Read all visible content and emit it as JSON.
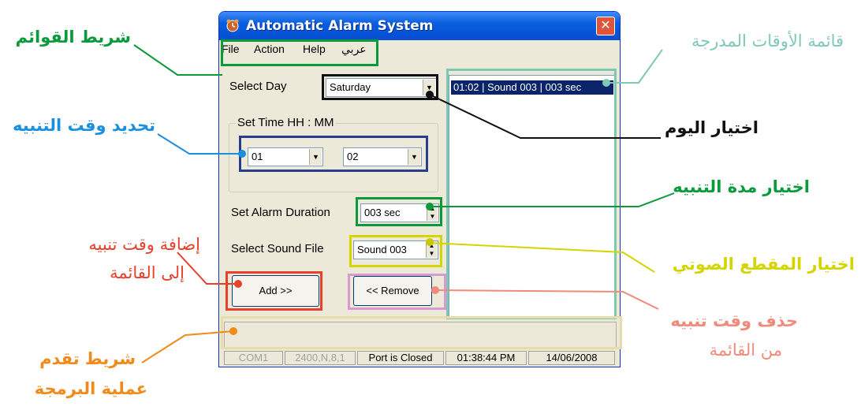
{
  "window": {
    "title": "Automatic Alarm System",
    "close_glyph": "✕",
    "app_icon": "alarm-icon"
  },
  "menu": {
    "items": [
      "File",
      "Action",
      "Help",
      "عربي"
    ]
  },
  "form": {
    "select_day_label": "Select Day",
    "day_value": "Saturday",
    "set_time_group": "Set Time  HH : MM",
    "hour_value": "01",
    "minute_value": "02",
    "duration_label": "Set Alarm Duration",
    "duration_value": "003 sec",
    "sound_label": "Select Sound File",
    "sound_value": "Sound 003",
    "add_button": "Add >>",
    "remove_button": "<< Remove"
  },
  "alarm_list": {
    "items": [
      "01:02 | Sound 003 | 003 sec"
    ]
  },
  "status": {
    "port": "COM1",
    "settings": "2400,N,8,1",
    "port_state": "Port is Closed",
    "time": "01:38:44 PM",
    "date": "14/06/2008"
  },
  "annotations": {
    "menubar": "شريط القوائم",
    "alarm_list": "قائمة الأوقات المدرجة",
    "set_time": "تحديد وقت التنبيه",
    "select_day": "اختيار اليوم",
    "duration": "اختيار مدة التنبيه",
    "sound": "اختيار المقطع الصوتي",
    "add_1": "إضافة وقت تنبيه",
    "add_2": "إلى القائمة",
    "remove_1": "حذف وقت تنبيه",
    "remove_2": "من القائمة",
    "progress_1": "شريط تقدم",
    "progress_2": "عملية البرمجة"
  },
  "colors": {
    "menubar": "#0a9a3c",
    "alarm_list": "#7fc8b4",
    "set_time": "#1a8fe0",
    "select_day": "#000000",
    "duration": "#0a9a3c",
    "sound": "#d4d400",
    "add": "#e8402a",
    "remove": "#f08a7a",
    "progress": "#f08a1a",
    "time_box": "#2a3c8c",
    "remove_box": "#d89ad0",
    "progress_box": "#e8dca8"
  }
}
